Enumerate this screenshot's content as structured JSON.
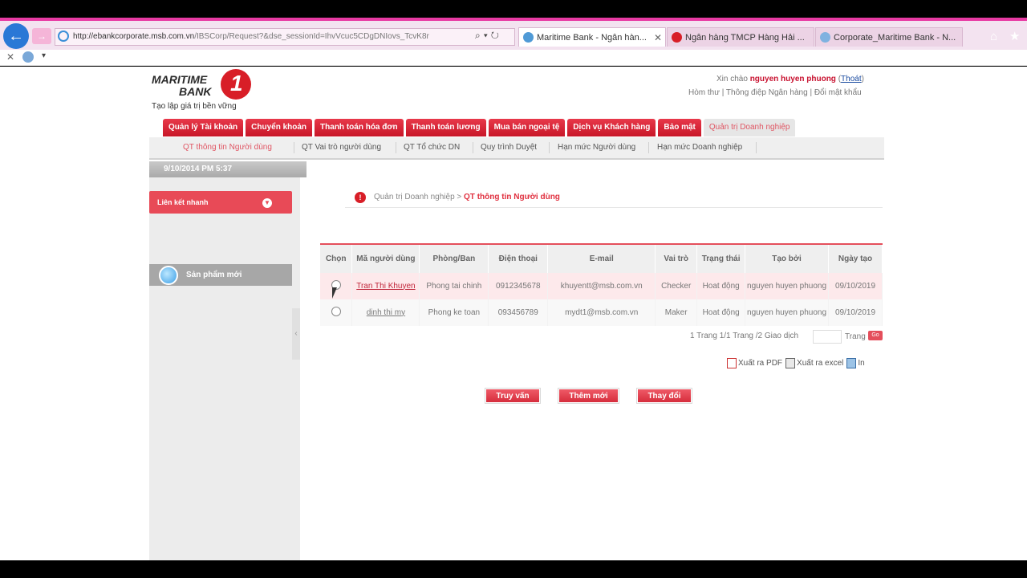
{
  "browser": {
    "url_host": "http://ebankcorporate.msb.com.vn",
    "url_rest": "/IBSCorp/Request?&dse_sessionId=IhvVcuc5CDgDNIovs_TcvK8r",
    "tabs": [
      {
        "label": "Maritime Bank - Ngân hàn...",
        "active": true
      },
      {
        "label": "Ngân hàng TMCP Hàng Hải ...",
        "active": false
      },
      {
        "label": "Corporate_Maritime Bank - N...",
        "active": false
      }
    ]
  },
  "header": {
    "logo_line1": "MARITIME",
    "logo_line2": "BANK",
    "slogan": "Tạo lập giá trị bền vững",
    "greeting_prefix": "Xin chào",
    "username": "nguyen huyen phuong",
    "logout": "Thoát",
    "links": [
      "Hòm thư",
      "Thông điệp Ngân hàng",
      "Đổi mật khẩu"
    ]
  },
  "mainnav": {
    "items": [
      "Quản lý Tài khoản",
      "Chuyển khoản",
      "Thanh toán hóa đơn",
      "Thanh toán lương",
      "Mua bán ngoại tệ",
      "Dịch vụ Khách hàng",
      "Bảo mật",
      "Quản trị Doanh nghiệp"
    ]
  },
  "subnav": {
    "items": [
      "QT thông tin Người dùng",
      "QT Vai trò người dùng",
      "QT Tổ chức DN",
      "Quy trình Duyệt",
      "Hạn mức Người dùng",
      "Hạn mức Doanh nghiệp"
    ]
  },
  "sidebar": {
    "datetime": "9/10/2014 PM 5:37",
    "quicklinks": "Liên kết nhanh",
    "newproducts": "Sản phẩm mới"
  },
  "breadcrumb": {
    "root": "Quản trị Doanh nghiệp",
    "separator": ">",
    "current": "QT thông tin Người dùng"
  },
  "table": {
    "headers": [
      "Chọn",
      "Mã người dùng",
      "Phòng/Ban",
      "Điện thoại",
      "E-mail",
      "Vai trò",
      "Trạng thái",
      "Tạo bởi",
      "Ngày tạo"
    ],
    "rows": [
      {
        "user": "Tran Thi Khuyen",
        "dept": "Phong tai chinh",
        "phone": "0912345678",
        "email": "khuyentt@msb.com.vn",
        "role": "Checker",
        "status": "Hoat động",
        "creator": "nguyen huyen phuong",
        "date": "09/10/2019"
      },
      {
        "user": "dinh thi my",
        "dept": "Phong ke toan",
        "phone": "093456789",
        "email": "mydt1@msb.com.vn",
        "role": "Maker",
        "status": "Hoat động",
        "creator": "nguyen huyen phuong",
        "date": "09/10/2019"
      }
    ]
  },
  "pager": {
    "summary": "1  Trang 1/1 Trang /2 Giao dịch",
    "page_label": "Trang",
    "go": "Go"
  },
  "exports": {
    "pdf": "Xuất ra PDF",
    "excel": "Xuất ra excel",
    "print": "In"
  },
  "actions": {
    "query": "Truy vấn",
    "add": "Thêm mới",
    "change": "Thay đổi"
  },
  "colors": {
    "accent": "#d81e27",
    "chrome": "#e83aa3"
  }
}
